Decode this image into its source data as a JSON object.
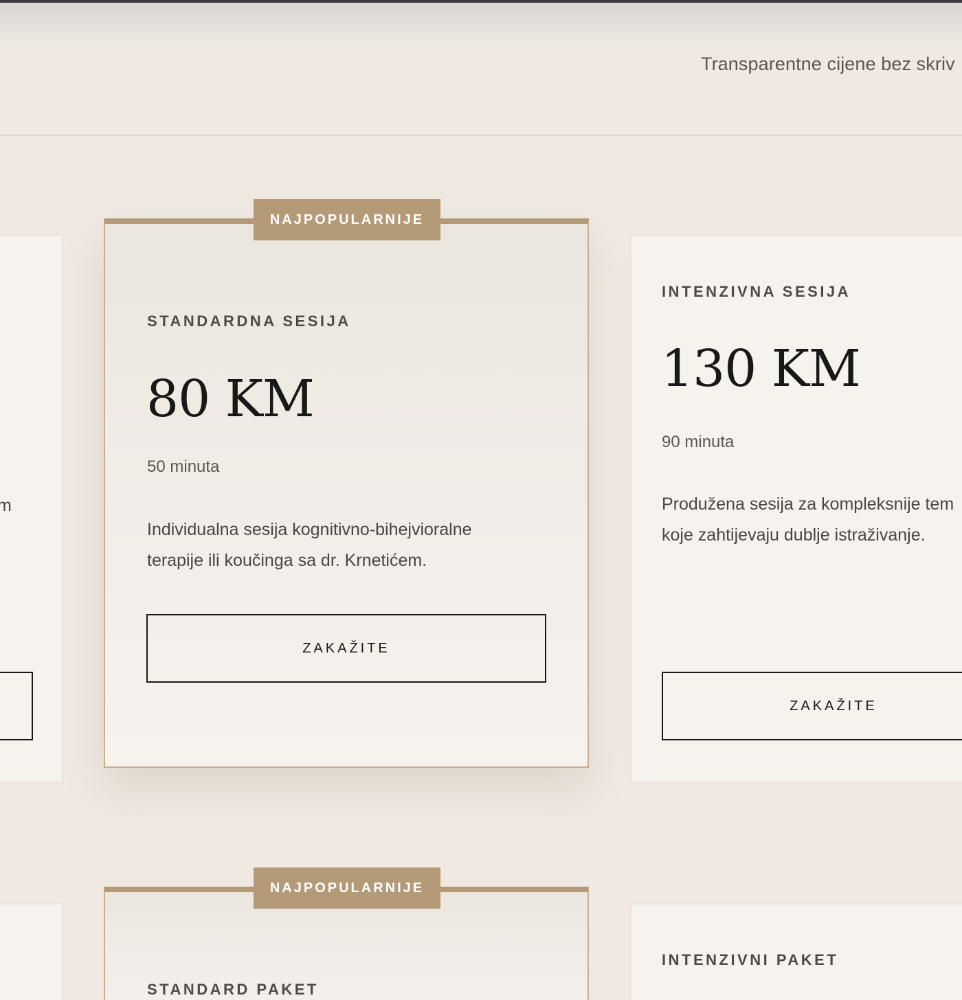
{
  "header": {
    "subtitle": "Transparentne cijene bez skriv"
  },
  "sessions": {
    "left_partial_desc": "m",
    "standard": {
      "badge": "NAJPOPULARNIJE",
      "name": "STANDARDNA SESIJA",
      "price": "80 KM",
      "duration": "50 minuta",
      "description": "Individualna sesija kognitivno-bihejvioralne terapije ili koučinga sa dr. Krnetićem.",
      "button": "ZAKAŽITE"
    },
    "intensive": {
      "name": "INTENZIVNA SESIJA",
      "price": "130 KM",
      "duration": "90 minuta",
      "description": "Produžena sesija za kompleksnije tem koje zahtijevaju dublje istraživanje.",
      "button": "ZAKAŽITE"
    }
  },
  "packages": {
    "standard": {
      "badge": "NAJPOPULARNIJE",
      "name": "STANDARD PAKET"
    },
    "intensive": {
      "name": "INTENZIVNI PAKET"
    }
  },
  "colors": {
    "background": "#efe9e2",
    "card": "#f6f3ef",
    "accent": "#b59a78",
    "text": "#1a1816"
  }
}
